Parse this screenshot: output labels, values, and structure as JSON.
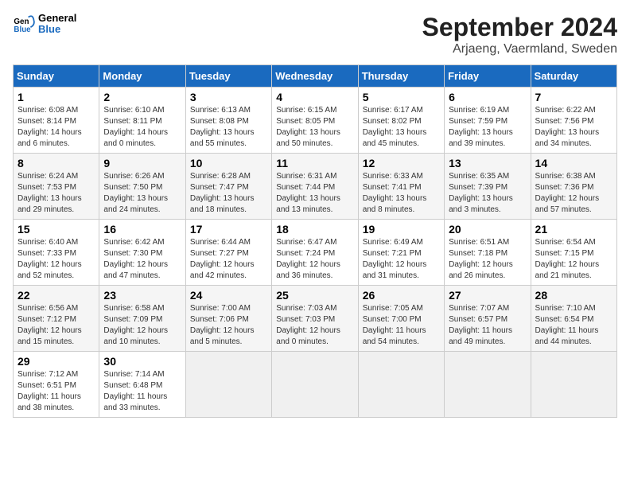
{
  "header": {
    "logo": {
      "line1": "General",
      "line2": "Blue"
    },
    "title": "September 2024",
    "subtitle": "Arjaeng, Vaermland, Sweden"
  },
  "days_of_week": [
    "Sunday",
    "Monday",
    "Tuesday",
    "Wednesday",
    "Thursday",
    "Friday",
    "Saturday"
  ],
  "weeks": [
    [
      {
        "day": "1",
        "sunrise": "6:08 AM",
        "sunset": "8:14 PM",
        "daylight": "14 hours and 6 minutes."
      },
      {
        "day": "2",
        "sunrise": "6:10 AM",
        "sunset": "8:11 PM",
        "daylight": "14 hours and 0 minutes."
      },
      {
        "day": "3",
        "sunrise": "6:13 AM",
        "sunset": "8:08 PM",
        "daylight": "13 hours and 55 minutes."
      },
      {
        "day": "4",
        "sunrise": "6:15 AM",
        "sunset": "8:05 PM",
        "daylight": "13 hours and 50 minutes."
      },
      {
        "day": "5",
        "sunrise": "6:17 AM",
        "sunset": "8:02 PM",
        "daylight": "13 hours and 45 minutes."
      },
      {
        "day": "6",
        "sunrise": "6:19 AM",
        "sunset": "7:59 PM",
        "daylight": "13 hours and 39 minutes."
      },
      {
        "day": "7",
        "sunrise": "6:22 AM",
        "sunset": "7:56 PM",
        "daylight": "13 hours and 34 minutes."
      }
    ],
    [
      {
        "day": "8",
        "sunrise": "6:24 AM",
        "sunset": "7:53 PM",
        "daylight": "13 hours and 29 minutes."
      },
      {
        "day": "9",
        "sunrise": "6:26 AM",
        "sunset": "7:50 PM",
        "daylight": "13 hours and 24 minutes."
      },
      {
        "day": "10",
        "sunrise": "6:28 AM",
        "sunset": "7:47 PM",
        "daylight": "13 hours and 18 minutes."
      },
      {
        "day": "11",
        "sunrise": "6:31 AM",
        "sunset": "7:44 PM",
        "daylight": "13 hours and 13 minutes."
      },
      {
        "day": "12",
        "sunrise": "6:33 AM",
        "sunset": "7:41 PM",
        "daylight": "13 hours and 8 minutes."
      },
      {
        "day": "13",
        "sunrise": "6:35 AM",
        "sunset": "7:39 PM",
        "daylight": "13 hours and 3 minutes."
      },
      {
        "day": "14",
        "sunrise": "6:38 AM",
        "sunset": "7:36 PM",
        "daylight": "12 hours and 57 minutes."
      }
    ],
    [
      {
        "day": "15",
        "sunrise": "6:40 AM",
        "sunset": "7:33 PM",
        "daylight": "12 hours and 52 minutes."
      },
      {
        "day": "16",
        "sunrise": "6:42 AM",
        "sunset": "7:30 PM",
        "daylight": "12 hours and 47 minutes."
      },
      {
        "day": "17",
        "sunrise": "6:44 AM",
        "sunset": "7:27 PM",
        "daylight": "12 hours and 42 minutes."
      },
      {
        "day": "18",
        "sunrise": "6:47 AM",
        "sunset": "7:24 PM",
        "daylight": "12 hours and 36 minutes."
      },
      {
        "day": "19",
        "sunrise": "6:49 AM",
        "sunset": "7:21 PM",
        "daylight": "12 hours and 31 minutes."
      },
      {
        "day": "20",
        "sunrise": "6:51 AM",
        "sunset": "7:18 PM",
        "daylight": "12 hours and 26 minutes."
      },
      {
        "day": "21",
        "sunrise": "6:54 AM",
        "sunset": "7:15 PM",
        "daylight": "12 hours and 21 minutes."
      }
    ],
    [
      {
        "day": "22",
        "sunrise": "6:56 AM",
        "sunset": "7:12 PM",
        "daylight": "12 hours and 15 minutes."
      },
      {
        "day": "23",
        "sunrise": "6:58 AM",
        "sunset": "7:09 PM",
        "daylight": "12 hours and 10 minutes."
      },
      {
        "day": "24",
        "sunrise": "7:00 AM",
        "sunset": "7:06 PM",
        "daylight": "12 hours and 5 minutes."
      },
      {
        "day": "25",
        "sunrise": "7:03 AM",
        "sunset": "7:03 PM",
        "daylight": "12 hours and 0 minutes."
      },
      {
        "day": "26",
        "sunrise": "7:05 AM",
        "sunset": "7:00 PM",
        "daylight": "11 hours and 54 minutes."
      },
      {
        "day": "27",
        "sunrise": "7:07 AM",
        "sunset": "6:57 PM",
        "daylight": "11 hours and 49 minutes."
      },
      {
        "day": "28",
        "sunrise": "7:10 AM",
        "sunset": "6:54 PM",
        "daylight": "11 hours and 44 minutes."
      }
    ],
    [
      {
        "day": "29",
        "sunrise": "7:12 AM",
        "sunset": "6:51 PM",
        "daylight": "11 hours and 38 minutes."
      },
      {
        "day": "30",
        "sunrise": "7:14 AM",
        "sunset": "6:48 PM",
        "daylight": "11 hours and 33 minutes."
      },
      null,
      null,
      null,
      null,
      null
    ]
  ]
}
